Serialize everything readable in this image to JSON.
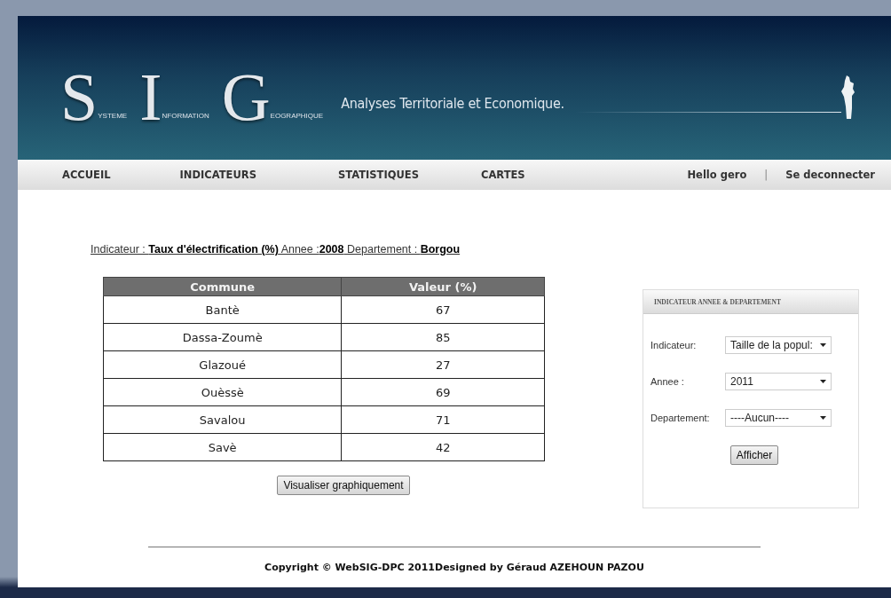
{
  "header": {
    "logo": [
      {
        "initial": "S",
        "rest": "YSTEME"
      },
      {
        "initial": "I",
        "rest": "NFORMATION"
      },
      {
        "initial": "G",
        "rest": "EOGRAPHIQUE"
      }
    ],
    "tagline": "Analyses Territoriale et Economique."
  },
  "nav": {
    "items": [
      "ACCUEIL",
      "INDICATEURS",
      "STATISTIQUES",
      "CARTES"
    ],
    "greeting": "Hello gero",
    "separator": "|",
    "logout": "Se deconnecter"
  },
  "summary": "Indicateur : **Taux d'électrification (%)** Annee :**2008** Departement : **Borgou**",
  "table": {
    "columns": [
      "Commune",
      "Valeur (%)"
    ],
    "rows": [
      [
        "Bantè",
        "67"
      ],
      [
        "Dassa-Zoumè",
        "85"
      ],
      [
        "Glazoué",
        "27"
      ],
      [
        "Ouèssè",
        "69"
      ],
      [
        "Savalou",
        "71"
      ],
      [
        "Savè",
        "42"
      ]
    ]
  },
  "chart_button": "Visualiser graphiquement",
  "filter_panel": {
    "title": "INDICATEUR ANNEE & DEPARTEMENT",
    "fields": [
      {
        "label": "Indicateur:",
        "value": "Taille de la popul:"
      },
      {
        "label": "Annee :",
        "value": "2011"
      },
      {
        "label": "Departement:",
        "value": "----Aucun----"
      }
    ],
    "button": "Afficher"
  },
  "footer": "Copyright © WebSIG-DPC 2011Designed by Géraud AZEHOUN PAZOU"
}
